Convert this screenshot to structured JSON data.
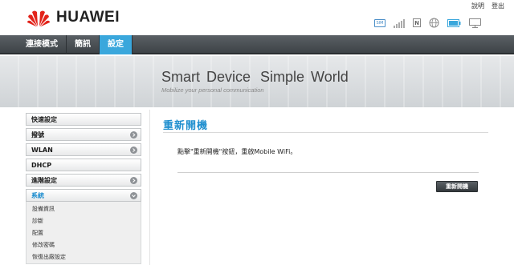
{
  "brand": {
    "name": "HUAWEI"
  },
  "top_links": {
    "help": "說明",
    "logout": "登出"
  },
  "status_icons": [
    "sim-icon",
    "signal-icon",
    "n-icon",
    "globe-icon",
    "battery-icon",
    "network-icon"
  ],
  "colors": {
    "accent": "#3aa7dc",
    "title_blue": "#1f8fcf",
    "nav_bg": "#4a4f53"
  },
  "nav": {
    "items": [
      {
        "label": "連接模式",
        "active": false
      },
      {
        "label": "簡訊",
        "active": false
      },
      {
        "label": "設定",
        "active": true
      }
    ]
  },
  "banner": {
    "title_a": "Smart Device",
    "title_b": "Simple World",
    "subtitle": "Mobilize your personal communication"
  },
  "sidebar": {
    "items": [
      {
        "label": "快速設定"
      },
      {
        "label": "撥號"
      },
      {
        "label": "WLAN"
      },
      {
        "label": "DHCP"
      },
      {
        "label": "進階設定"
      },
      {
        "label": "系統"
      }
    ],
    "system_sub": [
      {
        "label": "設備資訊"
      },
      {
        "label": "診斷"
      },
      {
        "label": "配置"
      },
      {
        "label": "修改密碼"
      },
      {
        "label": "恢復出廠設定"
      }
    ]
  },
  "content": {
    "title": "重新開機",
    "description": "點擊\"重新開機\"按鈕，重啟Mobile WiFi。",
    "button_label": "重新開機"
  }
}
